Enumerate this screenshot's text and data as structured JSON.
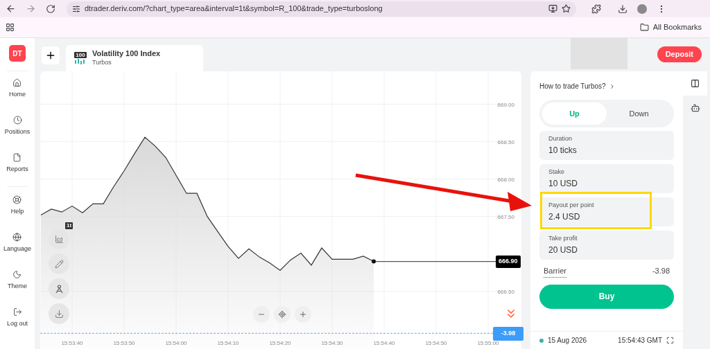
{
  "browser": {
    "url": "dtrader.deriv.com/?chart_type=area&interval=1t&symbol=R_100&trade_type=turboslong",
    "bookmarks_label": "All Bookmarks"
  },
  "sidebar": {
    "logo": "DT",
    "items": [
      {
        "label": "Home"
      },
      {
        "label": "Positions"
      },
      {
        "label": "Reports"
      },
      {
        "label": "Help"
      },
      {
        "label": "Language"
      },
      {
        "label": "Theme"
      },
      {
        "label": "Log out"
      }
    ]
  },
  "header": {
    "market_badge": "100",
    "market": "Volatility 100 Index",
    "trade_type": "Turbos",
    "deposit": "Deposit"
  },
  "chart": {
    "interval_badge": "1t",
    "current_price": "666.90",
    "barrier_badge": "-3.98",
    "chart_data": {
      "type": "area",
      "categories": [
        null,
        null,
        null,
        "15:53:40",
        null,
        null,
        null,
        null,
        "15:53:50",
        null,
        null,
        null,
        null,
        "15:54:00",
        null,
        null,
        null,
        null,
        "15:54:10",
        null,
        null,
        null,
        null,
        "15:54:20",
        null,
        null,
        null,
        null,
        "15:54:30",
        null,
        null,
        null,
        null,
        "15:54:40",
        null,
        null,
        null,
        null,
        "15:54:50",
        null,
        null,
        null,
        null,
        "15:55:00",
        null,
        null,
        null
      ],
      "series": [
        {
          "color": "#333333",
          "values": [
            667.52,
            667.6,
            667.56,
            667.64,
            667.55,
            667.67,
            667.67,
            667.9,
            668.11,
            668.34,
            668.56,
            668.44,
            668.29,
            668.05,
            667.81,
            667.81,
            667.5,
            667.3,
            667.1,
            666.94,
            667.07,
            666.96,
            666.88,
            666.78,
            666.92,
            667.01,
            666.85,
            667.08,
            666.93,
            666.93,
            666.93,
            666.97,
            666.9,
            null,
            null,
            null,
            null,
            null,
            null,
            null,
            null,
            null,
            null,
            null,
            null,
            null,
            null
          ]
        }
      ],
      "ylim": [
        665.73,
        669.44
      ],
      "grid": true,
      "ref_lines": [
        {
          "axis": "y",
          "value": 665.94,
          "color": "#63a9f3"
        }
      ],
      "yticks": [
        {
          "value": 666.5,
          "label": "666.50"
        },
        {
          "value": 667.5,
          "label": "667.50"
        },
        {
          "value": 668,
          "label": "668.00"
        },
        {
          "value": 668.5,
          "label": "668.50"
        },
        {
          "value": 669,
          "label": "669.00"
        }
      ]
    }
  },
  "trade": {
    "guide": "How to trade Turbos?",
    "directions": [
      {
        "label": "Up",
        "selected": true
      },
      {
        "label": "Down",
        "selected": false
      }
    ],
    "fields": [
      {
        "label": "Duration",
        "value": "10 ticks",
        "highlighted": false
      },
      {
        "label": "Stake",
        "value": "10 USD",
        "highlighted": false
      },
      {
        "label": "Payout per point",
        "value": "2.4 USD",
        "highlighted": true
      },
      {
        "label": "Take profit",
        "value": "20 USD",
        "highlighted": false
      }
    ],
    "barrier_label": "Barrier",
    "barrier_value": "-3.98",
    "buy": "Buy",
    "date": "15 Aug 2026",
    "time": "15:54:43 GMT"
  },
  "annotation_arrow": true
}
